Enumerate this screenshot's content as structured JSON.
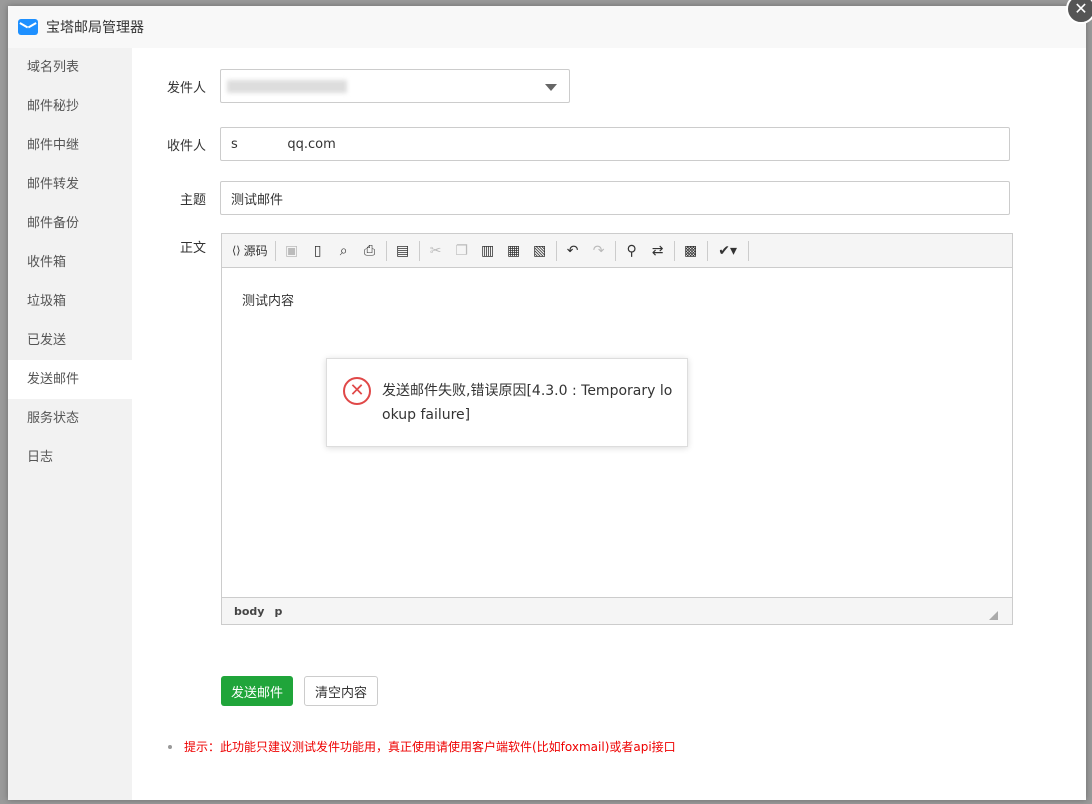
{
  "window": {
    "title": "宝塔邮局管理器",
    "close_icon": "close-icon",
    "close_glyph": "✕"
  },
  "sidebar": {
    "items": [
      {
        "label": "域名列表"
      },
      {
        "label": "邮件秘抄"
      },
      {
        "label": "邮件中继"
      },
      {
        "label": "邮件转发"
      },
      {
        "label": "邮件备份"
      },
      {
        "label": "收件箱"
      },
      {
        "label": "垃圾箱"
      },
      {
        "label": "已发送"
      },
      {
        "label": "发送邮件",
        "active": true
      },
      {
        "label": "服务状态"
      },
      {
        "label": "日志"
      }
    ]
  },
  "form": {
    "sender_label": "发件人",
    "recipient_label": "收件人",
    "recipient_value": "s            qq.com",
    "subject_label": "主题",
    "subject_value": "测试邮件",
    "body_label": "正文"
  },
  "editor": {
    "source_label": "源码",
    "content": "测试内容",
    "path_body": "body",
    "path_p": "p"
  },
  "buttons": {
    "send": "发送邮件",
    "clear": "清空内容"
  },
  "hint": "提示：此功能只建议测试发件功能用，真正使用请使用客户端软件(比如foxmail)或者api接口",
  "error_dialog": {
    "message": "发送邮件失败,错误原因[4.3.0 : Temporary lookup failure]",
    "glyph": "✕",
    "icon_color": "#e04848"
  },
  "colors": {
    "accent_green": "#20a53a",
    "hint_red": "#ee0000"
  }
}
